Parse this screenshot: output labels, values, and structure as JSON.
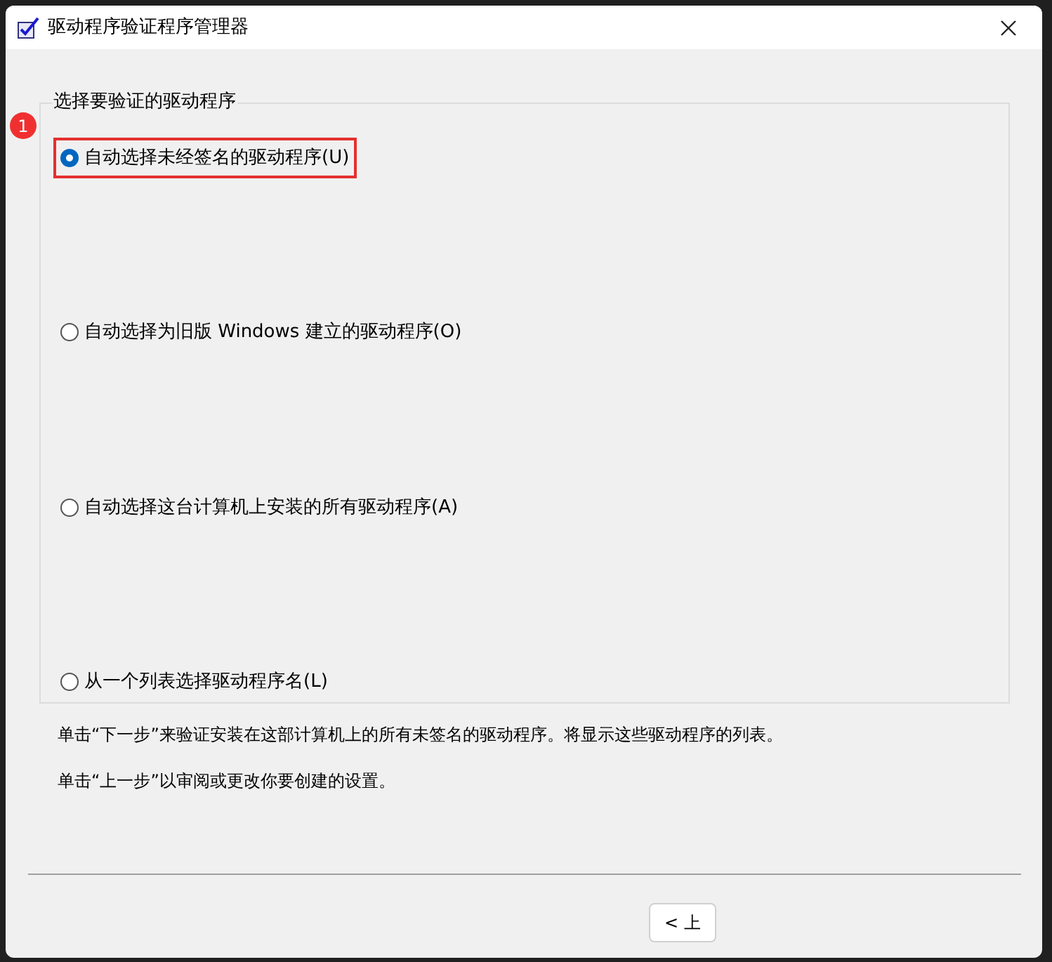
{
  "window": {
    "title": "驱动程序验证程序管理器"
  },
  "group": {
    "legend": "选择要验证的驱动程序",
    "annotation": "1",
    "options": [
      {
        "label": "自动选择未经签名的驱动程序(U)",
        "selected": true,
        "highlighted": true
      },
      {
        "label": "自动选择为旧版 Windows 建立的驱动程序(O)",
        "selected": false,
        "highlighted": false
      },
      {
        "label": "自动选择这台计算机上安装的所有驱动程序(A)",
        "selected": false,
        "highlighted": false
      },
      {
        "label": "从一个列表选择驱动程序名(L)",
        "selected": false,
        "highlighted": false
      }
    ]
  },
  "notes": [
    "单击“下一步”来验证安装在这部计算机上的所有未签名的驱动程序。将显示这些驱动程序的列表。",
    "单击“上一步”以审阅或更改你要创建的设置。"
  ],
  "buttons": [
    "< 上"
  ]
}
